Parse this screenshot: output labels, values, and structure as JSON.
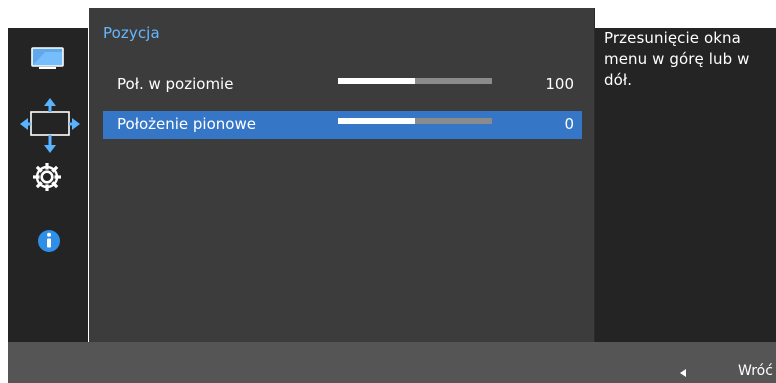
{
  "menu": {
    "title": "Pozycja",
    "sidebar_icons": [
      {
        "name": "picture-icon"
      },
      {
        "name": "position-icon"
      },
      {
        "name": "system-icon"
      },
      {
        "name": "info-icon"
      }
    ],
    "items": [
      {
        "label": "Poł. w poziomie",
        "value": "100",
        "level": 0.5,
        "selected": false
      },
      {
        "label": "Położenie pionowe",
        "value": "0",
        "level": 0.5,
        "selected": true
      }
    ]
  },
  "help": {
    "text": "Przesunięcie okna menu w górę lub w dół."
  },
  "footer": {
    "back_label": "Wróć",
    "back_icon": "left-arrow-icon"
  },
  "colors": {
    "accent": "#66b7ff",
    "selected_row": "#3577c6",
    "panel": "#3c3c3c",
    "side_panel": "#242424",
    "footer": "#555555"
  }
}
